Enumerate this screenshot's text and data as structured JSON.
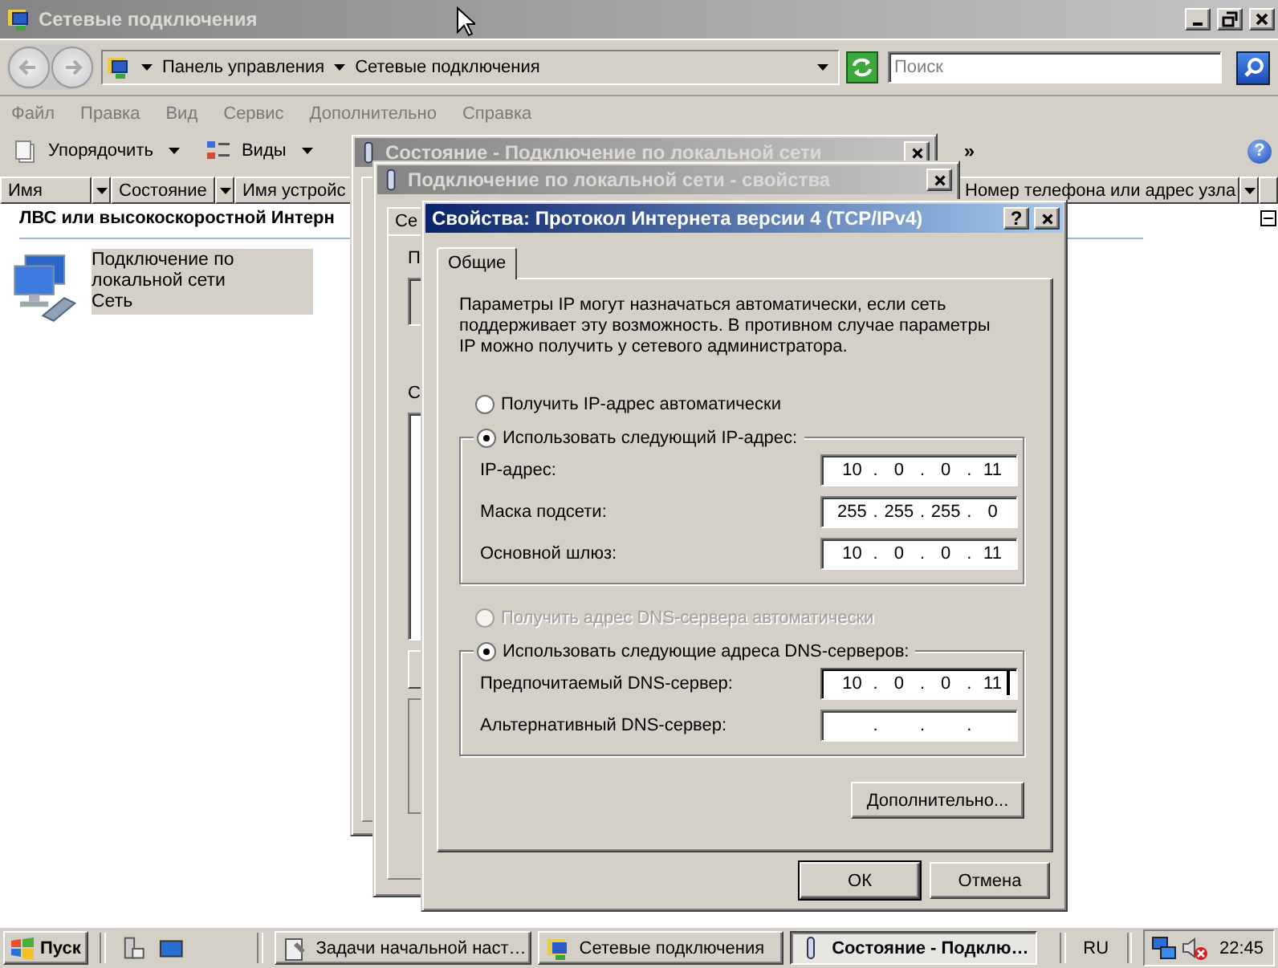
{
  "explorer": {
    "title": "Сетевые подключения",
    "active": false,
    "breadcrumbs": [
      "Панель управления",
      "Сетевые подключения"
    ],
    "search": {
      "placeholder": "Поиск"
    },
    "menu": [
      "Файл",
      "Правка",
      "Вид",
      "Сервис",
      "Дополнительно",
      "Справка"
    ],
    "toolbar": [
      {
        "label": "Упорядочить",
        "kind": "organize"
      },
      {
        "label": "Виды",
        "kind": "views"
      }
    ],
    "toolbar_overflow": "»",
    "help": "?",
    "columns": [
      "Имя",
      "Состояние",
      "Имя устройс",
      "Номер телефона или адрес узла"
    ],
    "group": {
      "title": "ЛВС или высокоскоростной Интерн",
      "expanded": true
    },
    "items": [
      {
        "name": "Подключение по локальной сети",
        "subtitle": "Сеть",
        "selected": true
      }
    ]
  },
  "status_dialog": {
    "title": "Состояние - Подключение по локальной сети",
    "active": false
  },
  "properties_dialog": {
    "title": "Подключение по локальной сети - свойства",
    "active": false,
    "tab": "Се",
    "labels": [
      "П",
      "С"
    ]
  },
  "ipv4_dialog": {
    "title": "Свойства: Протокол Интернета версии 4 (TCP/IPv4)",
    "active": true,
    "help_button": "?",
    "tabs": [
      {
        "label": "Общие",
        "selected": true
      }
    ],
    "description": "Параметры IP могут назначаться автоматически, если сеть поддерживает эту возможность. В противном случае параметры IP можно получить у сетевого администратора.",
    "ip_mode": [
      {
        "label": "Получить IP-адрес автоматически",
        "selected": false,
        "disabled": false
      },
      {
        "label": "Использовать следующий IP-адрес:",
        "selected": true,
        "disabled": false
      }
    ],
    "ip_fields": [
      {
        "label": "IP-адрес:",
        "octets": [
          "10",
          "0",
          "0",
          "11"
        ],
        "dots": [
          ".",
          ".",
          "."
        ],
        "focused": false
      },
      {
        "label": "Маска подсети:",
        "octets": [
          "255",
          "255",
          "255",
          "0"
        ],
        "dots": [
          ".",
          ".",
          "."
        ],
        "focused": false
      },
      {
        "label": "Основной шлюз:",
        "octets": [
          "10",
          "0",
          "0",
          "11"
        ],
        "dots": [
          ".",
          ".",
          "."
        ],
        "focused": false
      }
    ],
    "dns_mode": [
      {
        "label": "Получить адрес DNS-сервера автоматически",
        "selected": false,
        "disabled": true
      },
      {
        "label": "Использовать следующие адреса DNS-серверов:",
        "selected": true,
        "disabled": false
      }
    ],
    "dns_fields": [
      {
        "label": "Предпочитаемый DNS-сервер:",
        "octets": [
          "10",
          "0",
          "0",
          "11"
        ],
        "dots": [
          ".",
          ".",
          "."
        ],
        "focused": true
      },
      {
        "label": "Альтернативный DNS-сервер:",
        "dots": [
          ".",
          ".",
          "."
        ],
        "focused": false
      }
    ],
    "advanced_button": "Дополнительно...",
    "buttons": [
      {
        "label": "ОК",
        "default": true
      },
      {
        "label": "Отмена",
        "default": false
      }
    ]
  },
  "taskbar": {
    "start": "Пуск",
    "tasks": [
      {
        "label": "Задачи начальной наст…",
        "kind": "tasks",
        "selected": false
      },
      {
        "label": "Сетевые подключения",
        "kind": "network",
        "selected": false
      },
      {
        "label": "Состояние - Подклю…",
        "kind": "status",
        "selected": true
      }
    ],
    "language": "RU",
    "clock": "22:45"
  }
}
